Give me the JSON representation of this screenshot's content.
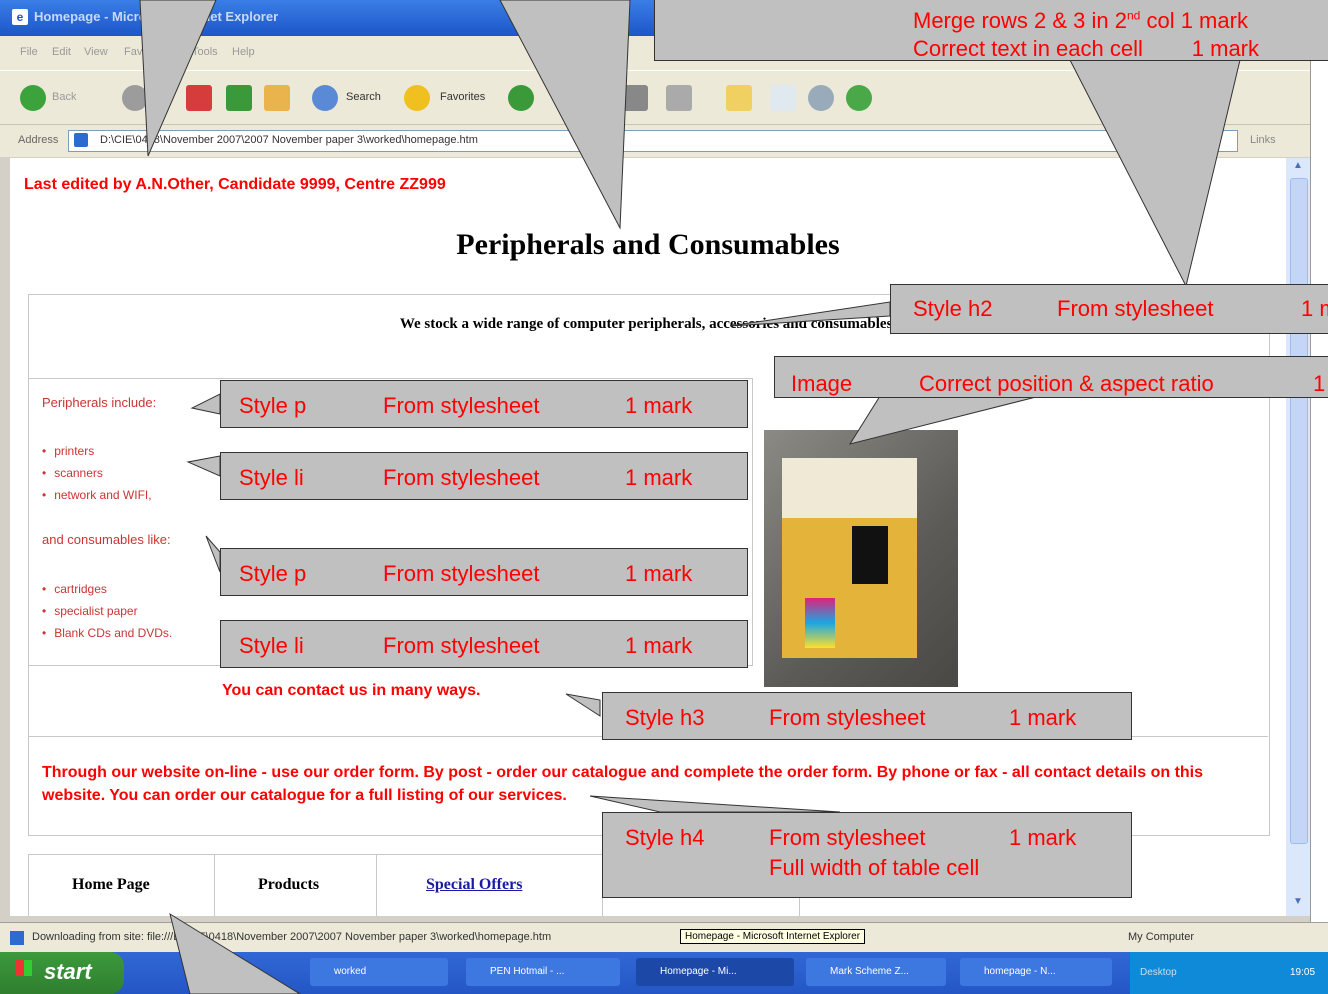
{
  "window": {
    "title": "Homepage - Microsoft Internet Explorer"
  },
  "menu": [
    "File",
    "Edit",
    "View",
    "Favorites",
    "Tools",
    "Help"
  ],
  "toolbar": {
    "back": "Back",
    "search": "Search",
    "favorites": "Favorites"
  },
  "address": {
    "label": "Address",
    "value": "D:\\CIE\\0418\\November 2007\\2007 November paper 3\\worked\\homepage.htm",
    "links": "Links"
  },
  "page": {
    "last_edited": "Last edited by A.N.Other, Candidate 9999, Centre ZZ999",
    "title": "Peripherals and Consumables",
    "stock_text": "We stock a wide range of computer peripherals, accessories and consumables.",
    "peripherals_intro": "Peripherals include:",
    "peripherals": [
      "printers",
      "scanners",
      "network and WIFI,"
    ],
    "consumables_intro": "and consumables like:",
    "consumables": [
      "cartridges",
      "specialist paper",
      "Blank CDs and DVDs."
    ],
    "contact_h3": "You can contact us in many ways.",
    "contact_h4": "Through our website on-line - use our order form. By post - order our catalogue and complete the order form. By phone or fax - all contact details on this website. You can order our catalogue for a full listing of our services.",
    "nav": [
      "Home Page",
      "Products",
      "Special Offers"
    ]
  },
  "callouts": {
    "top_right_line1": "Merge rows 2 & 3 in 2",
    "top_right_sup": "nd",
    "top_right_line1_tail": "col   1 mark",
    "top_right_line2": "Correct text in each cell        1 mark",
    "h2": [
      "Style h2",
      "From stylesheet",
      "1 m"
    ],
    "image": [
      "Image",
      "Correct position & aspect ratio",
      "1"
    ],
    "p1": [
      "Style p",
      "From stylesheet",
      "1 mark"
    ],
    "li1": [
      "Style li",
      "From stylesheet",
      "1 mark"
    ],
    "p2": [
      "Style p",
      "From stylesheet",
      "1 mark"
    ],
    "li2": [
      "Style li",
      "From stylesheet",
      "1 mark"
    ],
    "h3": [
      "Style h3",
      "From stylesheet",
      "1 mark"
    ],
    "h4": [
      "Style h4",
      "From stylesheet",
      "1 mark",
      "Full width of table cell"
    ]
  },
  "status": {
    "text": "Downloading from site: file:///D:\\CIE\\0418\\November 2007\\2007 November paper 3\\worked\\homepage.htm",
    "tooltip": "Homepage - Microsoft Internet Explorer",
    "zone": "My Computer"
  },
  "taskbar": {
    "start": "start",
    "tasks": [
      "worked",
      "PEN Hotmail - ...",
      "Homepage - Mi...",
      "Mark Scheme Z...",
      "homepage - N..."
    ],
    "tray": "Desktop",
    "clock": "19:05"
  }
}
